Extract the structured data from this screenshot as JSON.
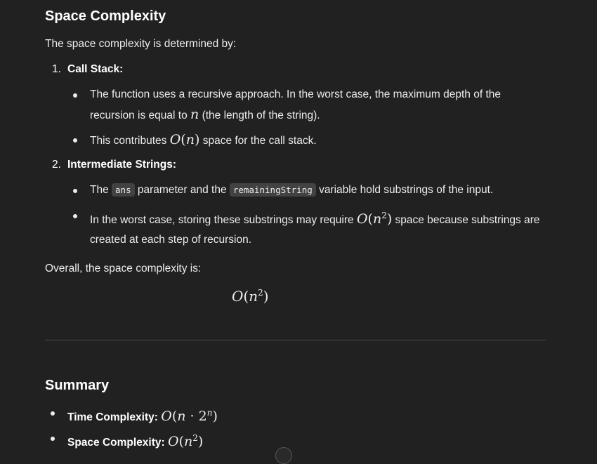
{
  "space": {
    "heading": "Space Complexity",
    "intro": "The space complexity is determined by:",
    "items": [
      {
        "number": "1.",
        "title": "Call Stack:",
        "bullets": [
          {
            "line1": "The function uses a recursive approach. In the worst case, the maximum depth of the",
            "line2_pre": "recursion is equal to ",
            "line2_math": "n",
            "line2_post": " (the length of the string)."
          },
          {
            "pre": "This contributes ",
            "math_fn": "O",
            "math_arg": "n",
            "post": " space for the call stack."
          }
        ]
      },
      {
        "number": "2.",
        "title": "Intermediate Strings:",
        "bullets": [
          {
            "pre": "The ",
            "code1": "ans",
            "mid": " parameter and the ",
            "code2": "remainingString",
            "post": " variable hold substrings of the input."
          },
          {
            "pre": "In the worst case, storing these substrings may require ",
            "math_fn": "O",
            "math_arg": "n",
            "math_exp": "2",
            "post": " space because substrings are",
            "line2": "created at each step of recursion."
          }
        ]
      }
    ],
    "overall": "Overall, the space complexity is:",
    "display": {
      "fn": "O",
      "arg": "n",
      "exp": "2"
    }
  },
  "summary": {
    "heading": "Summary",
    "items": [
      {
        "label": "Time Complexity:",
        "fn": "O",
        "arg": "n",
        "op": "·",
        "base": "2",
        "exp": "n"
      },
      {
        "label": "Space Complexity:",
        "fn": "O",
        "arg": "n",
        "exp": "2"
      }
    ]
  }
}
